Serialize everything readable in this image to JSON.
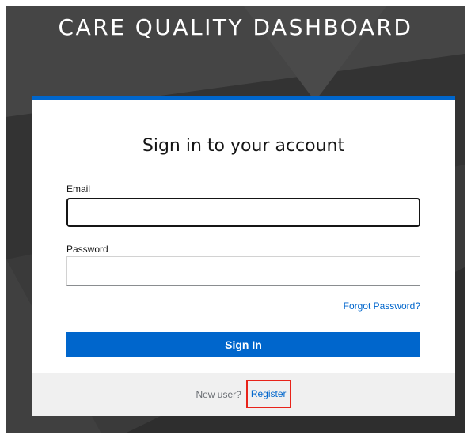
{
  "header": {
    "app_title": "CARE QUALITY DASHBOARD"
  },
  "login": {
    "heading": "Sign in to your account",
    "email_label": "Email",
    "email_value": "",
    "password_label": "Password",
    "password_value": "",
    "forgot_password_label": "Forgot Password?",
    "sign_in_label": "Sign In"
  },
  "footer": {
    "new_user_text": "New user?",
    "register_label": "Register"
  },
  "colors": {
    "accent": "#0066cc",
    "background": "#3a3a3a",
    "highlight": "#e8231a"
  }
}
